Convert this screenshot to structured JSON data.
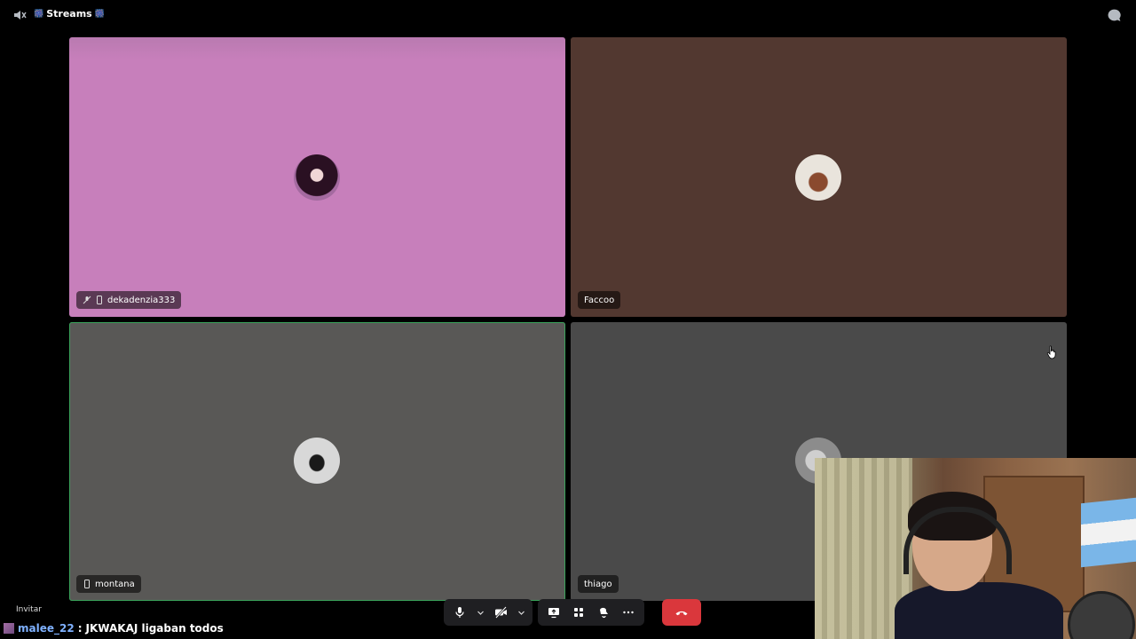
{
  "header": {
    "channel_name": "Streams",
    "channel_deco": "🎆",
    "left_icon": "speaker-muted-icon",
    "right_icon": "chat-bubble-icon"
  },
  "tiles": [
    {
      "name": "dekadenzia333",
      "bg": "#c77fbb",
      "icons": [
        "mic-muted-icon",
        "mobile-icon"
      ]
    },
    {
      "name": "Faccoo",
      "bg": "#523830",
      "icons": []
    },
    {
      "name": "montana",
      "bg": "#595856",
      "icons": [
        "mobile-icon"
      ],
      "speaking": true,
      "speaking_color": "#3aa35a"
    },
    {
      "name": "thiago",
      "bg": "#4a4a4a",
      "icons": []
    }
  ],
  "controls": {
    "buttons": [
      "microphone-icon",
      "chevron-down-icon",
      "camera-off-icon",
      "chevron-down-icon",
      "screen-share-icon",
      "activities-icon",
      "soundboard-icon",
      "more-icon",
      "hang-up-icon"
    ],
    "hangup_color": "#da373c"
  },
  "footer": {
    "invite_label": "Invitar",
    "chat": {
      "user": "malee_22",
      "separator": ":",
      "message": "JKWAKAJ ligaban todos",
      "user_color": "#7fb1ff"
    }
  }
}
